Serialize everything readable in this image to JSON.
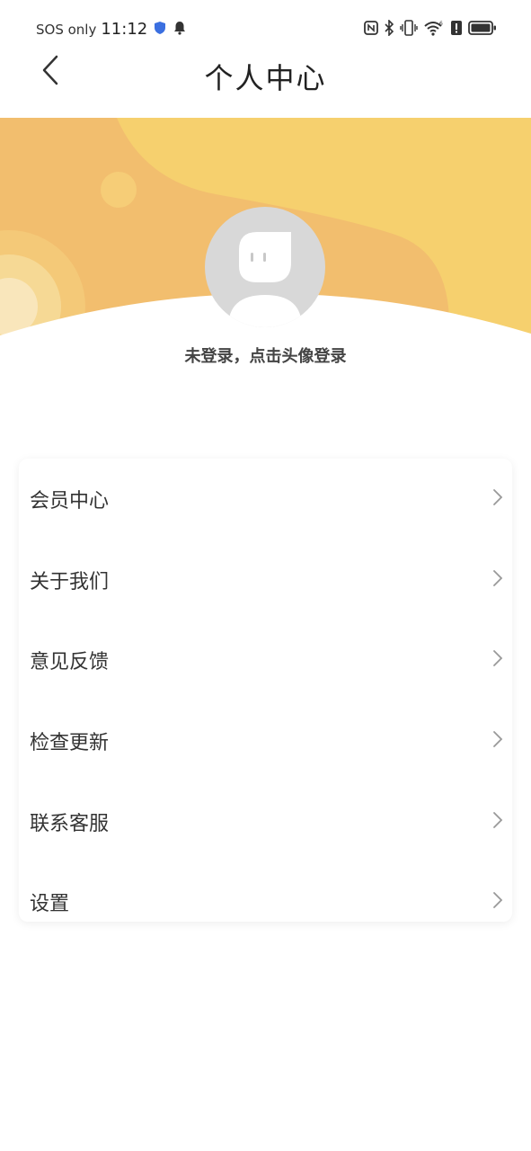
{
  "status_bar": {
    "carrier": "SOS only",
    "time": "11:12",
    "icons": [
      "shield-icon",
      "bell-icon",
      "nfc-icon",
      "bluetooth-icon",
      "vibrate-icon",
      "wifi-icon",
      "battery-saver-icon",
      "battery-icon"
    ]
  },
  "header": {
    "title": "个人中心",
    "back_icon": "chevron-left-icon"
  },
  "profile": {
    "login_hint": "未登录，点击头像登录"
  },
  "menu": {
    "items": [
      {
        "label": "会员中心"
      },
      {
        "label": "关于我们"
      },
      {
        "label": "意见反馈"
      },
      {
        "label": "检查更新"
      },
      {
        "label": "联系客服"
      },
      {
        "label": "设置"
      }
    ]
  },
  "colors": {
    "banner_light": "#F6D06E",
    "banner_dark": "#F2BE6E",
    "avatar_bg": "#D8D8D8"
  }
}
